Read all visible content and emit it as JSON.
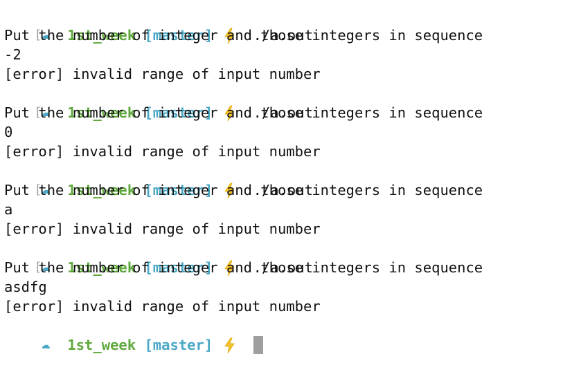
{
  "prompt": {
    "directory": "1st_week",
    "branch": "[master]"
  },
  "runs": [
    {
      "command": "./a.out",
      "message": "Put the number of integer and those integers in sequence",
      "input": "-2",
      "error": "[error] invalid range of input number"
    },
    {
      "command": "./a.out",
      "message": "Put the number of integer and those integers in sequence",
      "input": "0",
      "error": "[error] invalid range of input number"
    },
    {
      "command": "./a.out",
      "message": "Put the number of integer and those integers in sequence",
      "input": "a",
      "error": "[error] invalid range of input number"
    },
    {
      "command": "./a.out",
      "message": "Put the number of integer and those integers in sequence",
      "input": "asdfg",
      "error": "[error] invalid range of input number"
    }
  ],
  "colors": {
    "directory": "#5fa83c",
    "branch": "#4aa8c6",
    "bolt": "#f2c230",
    "cursor": "#9e9e9e"
  },
  "icons": {
    "prompt_marker": "cloud-icon",
    "vcs_status": "lightning-bolt-icon"
  }
}
